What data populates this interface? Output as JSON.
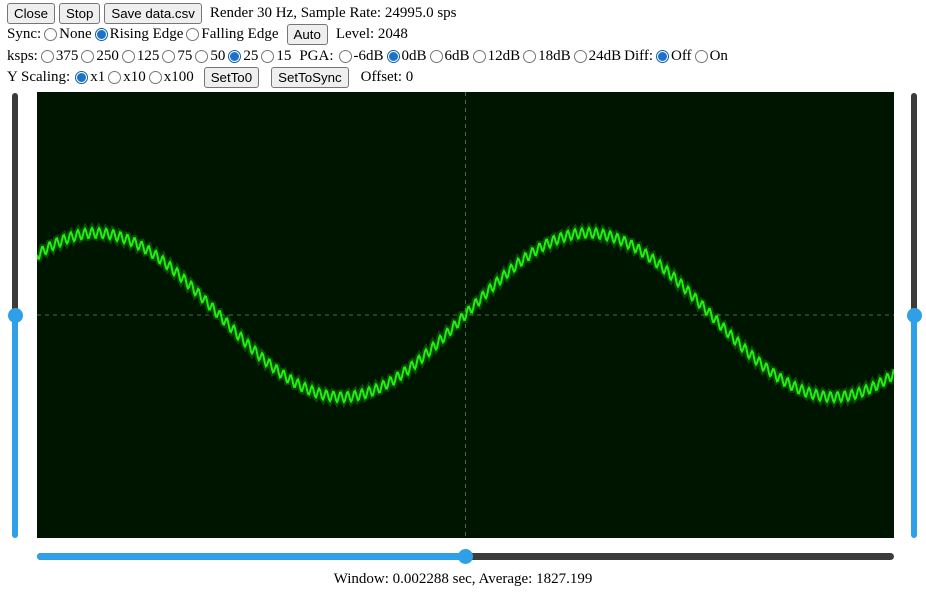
{
  "toolbar": {
    "close_label": "Close",
    "stop_label": "Stop",
    "save_label": "Save data.csv",
    "status": "Render 30 Hz, Sample Rate: 24995.0 sps"
  },
  "sync": {
    "label": "Sync:",
    "options": [
      "None",
      "Rising Edge",
      "Falling Edge"
    ],
    "selected": "Rising Edge",
    "auto_label": "Auto",
    "level_text": "Level: 2048"
  },
  "ksps": {
    "label": "ksps:",
    "options": [
      "375",
      "250",
      "125",
      "75",
      "50",
      "25",
      "15"
    ],
    "selected": "25"
  },
  "pga": {
    "label": "PGA:",
    "options": [
      "-6dB",
      "0dB",
      "6dB",
      "12dB",
      "18dB",
      "24dB"
    ],
    "selected": "0dB"
  },
  "diff": {
    "label": "Diff:",
    "options": [
      "Off",
      "On"
    ],
    "selected": "Off"
  },
  "yscaling": {
    "label": "Y Scaling:",
    "options": [
      "x1",
      "x10",
      "x100"
    ],
    "selected": "x1",
    "set_to_0_label": "SetTo0",
    "set_to_sync_label": "SetToSync",
    "offset_text": "Offset: 0"
  },
  "sliders": {
    "left_vertical_level": 0.5,
    "right_vertical_level": 0.5,
    "horizontal_level": 0.5
  },
  "scope": {
    "background_color": "#001500",
    "trace_color": "#22ee11",
    "grid_color": "#4a6a4a"
  },
  "footer": {
    "text": "Window: 0.002288 sec, Average: 1827.199"
  }
}
